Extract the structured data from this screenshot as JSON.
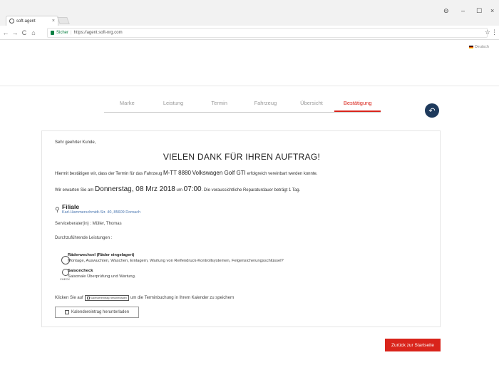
{
  "browser": {
    "tab_title": "soft-agent",
    "tab_close": "×",
    "back": "←",
    "forward": "→",
    "reload": "C",
    "home": "⌂",
    "secure_label": "Sicher",
    "url_separator": "|",
    "url": "https://agent.soft-nrg.com",
    "star": "☆",
    "menu": "⋮",
    "profile": "⊖",
    "minimize": "–",
    "maximize": "☐",
    "close": "×"
  },
  "header": {
    "language": "Deutsch"
  },
  "steps": [
    {
      "label": "Marke"
    },
    {
      "label": "Leistung"
    },
    {
      "label": "Termin"
    },
    {
      "label": "Fahrzeug"
    },
    {
      "label": "Übersicht"
    },
    {
      "label": "Bestätigung"
    }
  ],
  "active_step": 5,
  "back_button": "↶",
  "card": {
    "greeting": "Sehr geehrter Kunde,",
    "headline": "VIELEN DANK FÜR IHREN AUFTRAG!",
    "confirm_pre": "Hiermit bestätigen wir, dass der Termin für das Fahrzeug",
    "plate": "M-TT 8880",
    "car": "Volkswagen Golf GTI",
    "confirm_post": "erfolgreich vereinbart werden konnte.",
    "expect_pre": "Wir erwarten Sie am",
    "date": "Donnerstag, 08 Mrz 2018",
    "expect_mid": "um",
    "time": "07:00",
    "expect_post": ". Die voraussichtliche Reparaturdauer beträgt 1 Tag.",
    "branch_title": "Filiale",
    "branch_address": "Karl-Hammerschmidt-Str. 40, 85609 Dornach",
    "advisor": "Serviceberater(in) : Müller, Thomas",
    "services_label": "Durchzuführende Leistungen :",
    "services": [
      {
        "title": "Räderwechsel (Räder eingelagert)",
        "description": "Montage, Auswuchten, Waschen, Einlagern, Wartung von Reifendruck-Kontrollsystemen, Felgensicherungsschlüssel?",
        "tag": ""
      },
      {
        "title": "Saisoncheck",
        "description": "Saisonale Überprüfung und Wartung.",
        "tag": "CHECK"
      }
    ],
    "calendar_pre": "Klicken Sie auf",
    "calendar_inline_label": "Kalendereintrag herunterladen",
    "calendar_post": "um die Terminbuchung in Ihrem Kalender zu speichern",
    "calendar_button": "Kalendereintrag herunterladen"
  },
  "home_button": "Zurück zur Startseite",
  "colors": {
    "accent": "#d9241b",
    "back_button": "#1e3a5c",
    "link": "#4a76b0",
    "secure": "#0b8043"
  }
}
